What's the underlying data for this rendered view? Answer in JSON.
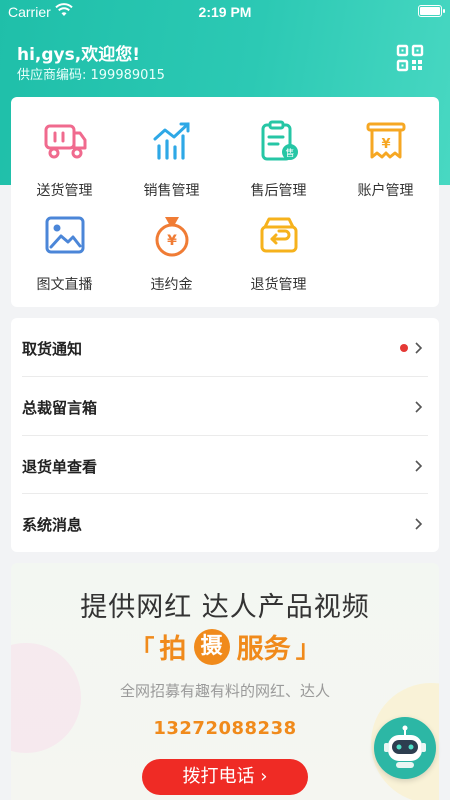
{
  "status_bar": {
    "carrier": "Carrier",
    "time": "2:19 PM"
  },
  "header": {
    "greeting": "hi,gys,欢迎您!",
    "supplier_code": "供应商编码: 199989015",
    "qr_icon": "qr-code-icon"
  },
  "menu": [
    {
      "label": "送货管理",
      "icon": "delivery-truck-icon",
      "color": "#f06a8e"
    },
    {
      "label": "销售管理",
      "icon": "sales-chart-icon",
      "color": "#2ea8e6"
    },
    {
      "label": "售后管理",
      "icon": "after-sales-icon",
      "color": "#26c6a5"
    },
    {
      "label": "账户管理",
      "icon": "account-bill-icon",
      "color": "#f6a723"
    },
    {
      "label": "图文直播",
      "icon": "image-live-icon",
      "color": "#4b86d8"
    },
    {
      "label": "违约金",
      "icon": "money-bag-icon",
      "color": "#f07c35"
    },
    {
      "label": "退货管理",
      "icon": "return-box-icon",
      "color": "#f6b21c"
    }
  ],
  "list": [
    {
      "label": "取货通知",
      "has_dot": true
    },
    {
      "label": "总裁留言箱",
      "has_dot": false
    },
    {
      "label": "退货单查看",
      "has_dot": false
    },
    {
      "label": "系统消息",
      "has_dot": false
    }
  ],
  "banner": {
    "title": "提供网红 达人产品视频",
    "service_left": "拍",
    "service_mid": "摄",
    "service_right": "服务",
    "bracket_open": "「",
    "bracket_close": "」",
    "subtitle": "全网招募有趣有料的网红、达人",
    "phone": "13272088238",
    "call_button": "拨打电话 ›"
  },
  "colors": {
    "accent": "#2cc9b4",
    "orange": "#f08a1b",
    "red": "#ef2b25"
  }
}
